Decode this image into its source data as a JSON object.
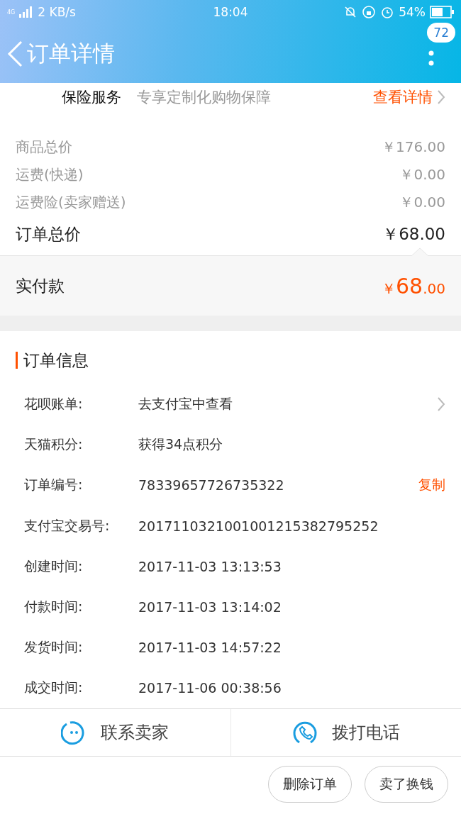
{
  "status_bar": {
    "network": "4G",
    "speed": "2 KB/s",
    "time": "18:04",
    "battery": "54%"
  },
  "header": {
    "title": "订单详情",
    "badge": "72"
  },
  "insurance": {
    "label": "保险服务",
    "description": "专享定制化购物保障",
    "link": "查看详情"
  },
  "prices": [
    {
      "label": "商品总价",
      "value": "￥176.00",
      "kind": "minor"
    },
    {
      "label": "运费(快递)",
      "value": "￥0.00",
      "kind": "minor"
    },
    {
      "label": "运费险(卖家赠送)",
      "value": "￥0.00",
      "kind": "minor"
    },
    {
      "label": "订单总价",
      "value": "￥68.00",
      "kind": "total"
    }
  ],
  "paid": {
    "label": "实付款",
    "currency": "￥",
    "integer": "68",
    "decimal": ".00"
  },
  "order_info": {
    "title": "订单信息",
    "rows": [
      {
        "label": "花呗账单:",
        "value": "去支付宝中查看",
        "kind": "link"
      },
      {
        "label": "天猫积分:",
        "value": "获得34点积分",
        "kind": "plain"
      },
      {
        "label": "订单编号:",
        "value": "78339657726735322",
        "kind": "copy",
        "action": "复制"
      },
      {
        "label": "支付宝交易号:",
        "value": "2017110321001001215382795252",
        "kind": "plain"
      },
      {
        "label": "创建时间:",
        "value": "2017-11-03 13:13:53",
        "kind": "plain"
      },
      {
        "label": "付款时间:",
        "value": "2017-11-03 13:14:02",
        "kind": "plain"
      },
      {
        "label": "发货时间:",
        "value": "2017-11-03 14:57:22",
        "kind": "plain"
      },
      {
        "label": "成交时间:",
        "value": "2017-11-06 00:38:56",
        "kind": "plain"
      }
    ]
  },
  "contact_bar": [
    {
      "label": "联系卖家",
      "kind": "chat"
    },
    {
      "label": "拨打电话",
      "kind": "phone"
    }
  ],
  "buttons": [
    "删除订单",
    "卖了换钱"
  ]
}
